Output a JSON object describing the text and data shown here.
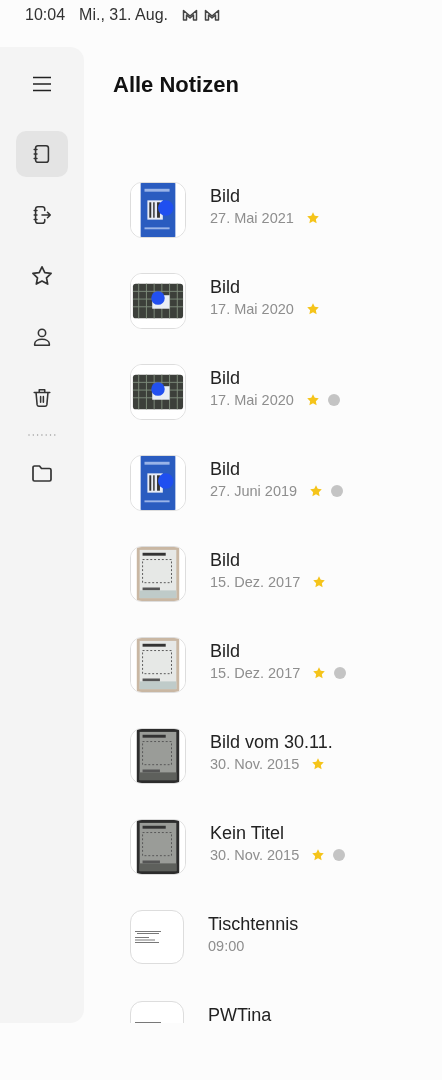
{
  "status_bar": {
    "time": "10:04",
    "date": "Mi., 31. Aug.",
    "notification_icons": [
      {
        "kind": "mail"
      },
      {
        "kind": "mail"
      }
    ]
  },
  "sidebar": {
    "items": [
      {
        "kind": "notes",
        "selected": true
      },
      {
        "kind": "shared",
        "selected": false
      },
      {
        "kind": "favorites",
        "selected": false
      },
      {
        "kind": "account",
        "selected": false
      },
      {
        "kind": "trash",
        "selected": false
      }
    ],
    "folders": [
      {
        "kind": "folder",
        "selected": false
      }
    ]
  },
  "title": "Alle Notizen",
  "notes": [
    {
      "title": "Bild",
      "date": "27. Mai 2021",
      "favorite": true,
      "tagged": false,
      "thumbnail": {
        "kind": "screen"
      }
    },
    {
      "title": "Bild",
      "date": "17. Mai 2020",
      "favorite": true,
      "tagged": false,
      "thumbnail": {
        "kind": "grid"
      }
    },
    {
      "title": "Bild",
      "date": "17. Mai 2020",
      "favorite": true,
      "tagged": true,
      "thumbnail": {
        "kind": "grid"
      }
    },
    {
      "title": "Bild",
      "date": "27. Juni 2019",
      "favorite": true,
      "tagged": true,
      "thumbnail": {
        "kind": "screen"
      }
    },
    {
      "title": "Bild",
      "date": "15. Dez. 2017",
      "favorite": true,
      "tagged": false,
      "thumbnail": {
        "kind": "sheet"
      }
    },
    {
      "title": "Bild",
      "date": "15. Dez. 2017",
      "favorite": true,
      "tagged": true,
      "thumbnail": {
        "kind": "sheet"
      }
    },
    {
      "title": "Bild vom 30.11.",
      "date": "30. Nov. 2015",
      "favorite": true,
      "tagged": false,
      "thumbnail": {
        "kind": "dark_sheet"
      }
    },
    {
      "title": "Kein Titel",
      "date": "30. Nov. 2015",
      "favorite": true,
      "tagged": true,
      "thumbnail": {
        "kind": "dark_sheet"
      }
    },
    {
      "title": "Tischtennis",
      "date": "09:00",
      "favorite": false,
      "tagged": false,
      "thumbnail": {
        "kind": "text"
      }
    },
    {
      "title": "PWTina",
      "favorite": false,
      "tagged": false,
      "thumbnail": {
        "kind": "text"
      }
    }
  ]
}
